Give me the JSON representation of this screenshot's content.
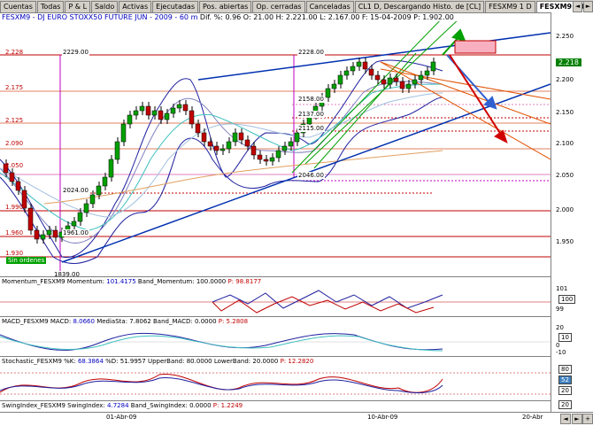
{
  "tabs": [
    "Cuentas",
    "Todas",
    "P & L",
    "Saldo",
    "Activas",
    "Ejecutadas",
    "Pos. abiertas",
    "Op. cerradas",
    "Canceladas",
    "CL1 D, Descargando Histo. de [CL]",
    "FESXM9 1 D",
    "FESXM9 60 m",
    "FESXM9"
  ],
  "active_tab": 11,
  "tab_nav": [
    "◄",
    "►"
  ],
  "header": {
    "symbol": "FESXM9 - DJ EURO STOXX50 FUTURE  JUN - 2009 - 60 m",
    "stats": "Dif. %: 0.96  O: 21.00  H: 2.221.00  L: 2.167.00  F: 15-04-2009  P: 1.902.00"
  },
  "price_axis": [
    "2.250",
    "2.200",
    "2.150",
    "2.100",
    "2.050",
    "2.000",
    "1.950"
  ],
  "current_price": "2.218",
  "levels": [
    "2.228",
    "2.175",
    "2.125",
    "2.090",
    "2.050",
    "1.990",
    "1.960",
    "1.930"
  ],
  "annotations": [
    "2229.00",
    "2228.00",
    "2158.00",
    "2137.00",
    "2115.00",
    "2046.00",
    "2024.00",
    "1961.00",
    "1839.00"
  ],
  "sin_ordenes": "Sin ordenes",
  "panels": [
    {
      "name": "Momentum",
      "label_a": "Momentum_FESXM9 Momentum: ",
      "val_a": "101.4175",
      "label_b": " Band_Momentum: 100.0000",
      "label_c": " P: 98.8177",
      "axis": [
        "101",
        "100",
        "99"
      ],
      "badge": "100"
    },
    {
      "name": "MACD",
      "label_a": "MACD_FESXM9 MACD: ",
      "val_a": "8.0660",
      "label_b": " MediaSta: 7.8062  Band_MACD: 0.0000",
      "label_c": " P: 5.2808",
      "axis": [
        "20",
        "10",
        "0",
        "-10"
      ],
      "badge": "10"
    },
    {
      "name": "Stochastic",
      "label_a": "Stochastic_FESXM9 %K: ",
      "val_a": "68.3864",
      "label_b": " %D: 51.9957  UpperBand: 80.0000  LowerBand: 20.0000",
      "label_c": " P: 12.2820",
      "axis": [
        "80",
        "52",
        "20"
      ],
      "badge": "52"
    },
    {
      "name": "SwingIndex",
      "label_a": "SwingIndex_FESXM9 SwingIndex: ",
      "val_a": "4.7284",
      "label_b": " Band_SwingIndex: 0.0000",
      "label_c": " P: 1.2249",
      "axis": [
        "20"
      ],
      "badge": "20"
    }
  ],
  "dates": [
    "01-Abr-09",
    "10-Abr-09",
    "20-Abr"
  ],
  "colors": {
    "up": "#00a000",
    "down": "#c00000",
    "bands": "#2020a0",
    "trend": "#0030b0",
    "channel": "#00a000",
    "fan": "#e05000",
    "arrow_blue": "#3060d0",
    "arrow_red": "#d00000"
  }
}
